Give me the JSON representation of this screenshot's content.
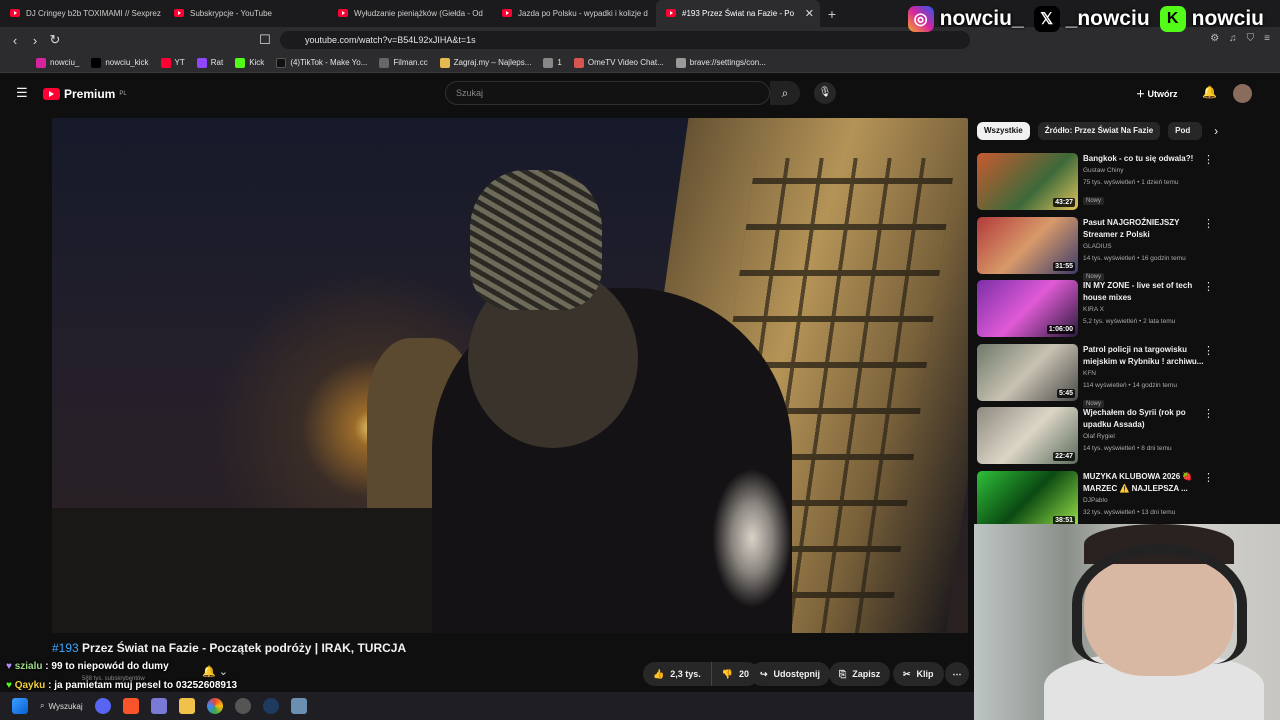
{
  "browser": {
    "tabs": [
      {
        "label": "DJ Cringey b2b TOXIMAMI // Sexprez"
      },
      {
        "label": "Subskrypcje - YouTube"
      },
      {
        "label": "Wyłudzanie pieniążków (Giełda - Od"
      },
      {
        "label": "Jazda po Polsku - wypadki i kolizje d"
      },
      {
        "label": "#193 Przez Świat na Fazie - Po"
      }
    ],
    "url": "youtube.com/watch?v=B54L92xJIHA&t=1s",
    "bookmarks": [
      {
        "label": "nowciu_",
        "color": "#d6249f"
      },
      {
        "label": "nowciu_kick",
        "color": "#000000"
      },
      {
        "label": "YT",
        "color": "#ff0033"
      },
      {
        "label": "Rat",
        "color": "#9146ff"
      },
      {
        "label": "Kick",
        "color": "#53fc18"
      },
      {
        "label": "(4)TikTok - Make Yo...",
        "color": "#111111"
      },
      {
        "label": "Filman.cc",
        "color": "#666666"
      },
      {
        "label": "Zagraj.my – Najleps...",
        "color": "#e5b94e"
      },
      {
        "label": "1",
        "color": "#888888"
      },
      {
        "label": "OmeTV Video Chat...",
        "color": "#d9534f"
      },
      {
        "label": "brave://settings/con...",
        "color": "#999999"
      }
    ]
  },
  "overlay": {
    "instagram": "nowciu_",
    "x": "_nowciu",
    "kick": "nowciu"
  },
  "youtube": {
    "logo": "Premium",
    "logo_region": "PL",
    "search_placeholder": "Szukaj",
    "create_label": "Utwórz",
    "video": {
      "number": "#193",
      "title": "Przez Świat na Fazie - Początek podróży | IRAK, TURCJA",
      "subscribers": "588 tys. subskrybentów",
      "likes": "2,3 tys.",
      "dislikes": "20",
      "share": "Udostępnij",
      "save": "Zapisz",
      "clip": "Klip"
    },
    "chips": [
      "Wszystkie",
      "Źródło: Przez Świat Na Fazie",
      "Pod"
    ],
    "recommendations": [
      {
        "title": "Bangkok - co tu się odwala?!",
        "channel": "Gustaw Chiny",
        "stats": "75 tys. wyświetleń • 1 dzień temu",
        "badge": "Nowy",
        "duration": "43:27",
        "thumb": "#c85a2f"
      },
      {
        "title": "Pasut NAJGROŹNIEJSZY Streamer z Polski",
        "channel": "GLADIUS",
        "stats": "14 tys. wyświetleń • 16 godzin temu",
        "badge": "Nowy",
        "duration": "31:55",
        "thumb": "#b23a3a"
      },
      {
        "title": "IN MY ZONE - live set of tech house mixes",
        "channel": "KIRA X",
        "stats": "5,2 tys. wyświetleń • 2 lata temu",
        "badge": "",
        "duration": "1:06:00",
        "thumb": "#7b2fa8"
      },
      {
        "title": "Patrol policji na targowisku miejskim w Rybniku ! archiwu...",
        "channel": "KFN",
        "stats": "114 wyświetleń • 14 godzin temu",
        "badge": "Nowy",
        "duration": "5:45",
        "thumb": "#6e7a6a"
      },
      {
        "title": "Wjechałem do Syrii (rok po upadku Assada)",
        "channel": "Olaf Rygiel",
        "stats": "14 tys. wyświetleń • 8 dni temu",
        "badge": "",
        "duration": "22:47",
        "thumb": "#8e8a80"
      },
      {
        "title": "MUZYKA KLUBOWA 2026 🍓 MARZEC ⚠️ NAJLEPSZA ...",
        "channel": "DJPablo",
        "stats": "32 tys. wyświetleń • 13 dni temu",
        "badge": "",
        "duration": "38:51",
        "thumb": "#2fbf3a"
      }
    ]
  },
  "chat": [
    {
      "user": "szialu",
      "text": "99 to niepowód do dumy"
    },
    {
      "user": "Qayku",
      "text": "ja pamietam muj pesel to 03252608913"
    }
  ],
  "taskbar": {
    "search": "Wyszukaj"
  }
}
